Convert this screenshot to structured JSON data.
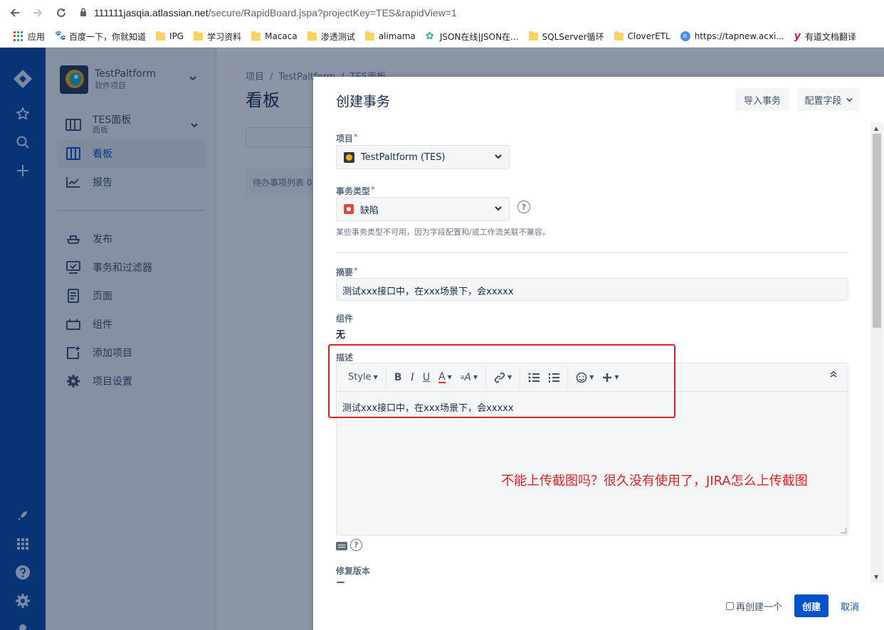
{
  "browser": {
    "url_host": "111111jasqia.atlassian.net",
    "url_path": "/secure/RapidBoard.jspa?projectKey=TES&rapidView=1",
    "bookmarks": [
      "应用",
      "百度一下，你就知道",
      "IPG",
      "学习资料",
      "Macaca",
      "渗透测试",
      "alimama",
      "JSON在线|JSON在...",
      "SQLServer循环",
      "CloverETL",
      "https://tapnew.acxi...",
      "有道文档翻译"
    ]
  },
  "sidebar": {
    "project_name": "TestPaltform",
    "project_type": "软件项目",
    "board_name": "TES面板",
    "board_sub": "面板",
    "items": [
      "看板",
      "报告",
      "发布",
      "事务和过滤器",
      "页面",
      "组件",
      "添加项目",
      "项目设置"
    ]
  },
  "page": {
    "crumbs": [
      "项目",
      "TestPaltform",
      "TES面板"
    ],
    "title": "看板",
    "backlog_stub": "待办事项列表 0"
  },
  "dialog": {
    "title": "创建事务",
    "import_btn": "导入事务",
    "configure_btn": "配置字段",
    "project_label": "项目",
    "project_value": "TestPaltform (TES)",
    "issuetype_label": "事务类型",
    "issuetype_value": "缺陷",
    "issuetype_hint": "某些事务类型不可用，因为字段配置和/或工作流关联不兼容。",
    "summary_label": "摘要",
    "summary_value": "测试xxx接口中，在xxx场景下，会xxxxx",
    "component_label": "组件",
    "component_value": "无",
    "description_label": "描述",
    "description_value": "测试xxx接口中，在xxx场景下，会xxxxx",
    "toolbar_style": "Style",
    "fixversion_label": "修复版本",
    "fixversion_value": "无",
    "create_another": "再创建一个",
    "create_btn": "创建",
    "cancel_btn": "取消"
  },
  "annotation": {
    "text": "不能上传截图吗？很久没有使用了，JIRA怎么上传截图",
    "color": "#e02020"
  },
  "colors": {
    "global_nav": "#0747a6",
    "primary": "#0052cc",
    "required": "#de350b"
  }
}
